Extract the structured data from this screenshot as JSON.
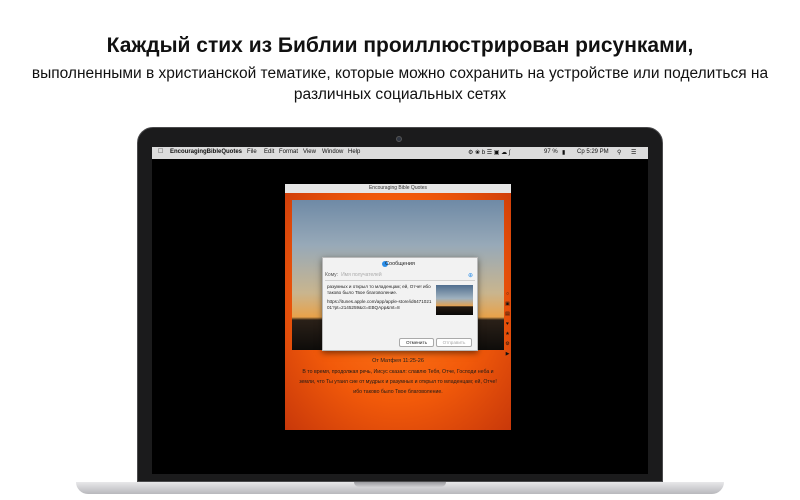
{
  "headline": "Каждый стих из Библии проиллюстрирован рисунками,",
  "subline": "выполненными в христианской тематике,  которые можно сохранить на устройстве или поделиться на различных социальных сетях",
  "menubar": {
    "app_name": "EncouragingBibleQuotes",
    "items": [
      "File",
      "Edit",
      "Format",
      "View",
      "Window",
      "Help"
    ],
    "battery": "97 %",
    "clock": "Ср 5:29 PM"
  },
  "app_window": {
    "title": "Encouraging Bible Quotes",
    "verse_ref": "От Матфея 11:25-26",
    "verse_text": "В то время, продолжая речь, Иисус сказал: славлю Тебя, Отче, Господи неба и земли, что Ты утаил сие от мудрых и разумных и открыл то младенцам; ей, Отче! ибо таково было Твое благоволение."
  },
  "message_sheet": {
    "title": "Сообщения",
    "to_label": "Кому:",
    "to_placeholder": "Имя получателей",
    "body": "разумных и открыл то младенцам; ей, Отче! ибо таково было Твое благоволение.",
    "link": "https://itunes.apple.com/app/apple-store/id647102101?pt=2145259&ct=EBQApp&mt=8",
    "cancel_label": "Отменить",
    "send_label": "Отправить"
  }
}
